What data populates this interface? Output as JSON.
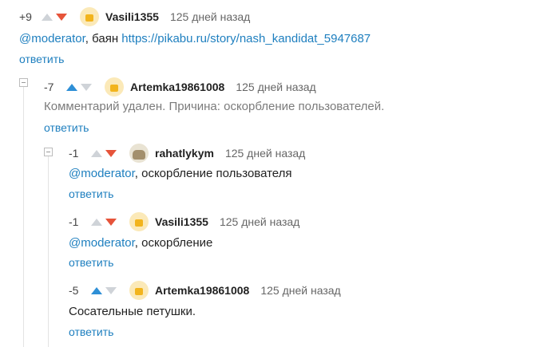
{
  "comments": [
    {
      "rating": "+9",
      "vote": "down",
      "avatar_icon": "default-avatar-icon",
      "user": "Vasili1355",
      "date": "125 дней назад",
      "body": {
        "mention": "@moderator",
        "text": ", баян ",
        "url": "https://pikabu.ru/story/nash_kandidat_5947687"
      },
      "reply_label": "ответить"
    },
    {
      "rating": "-7",
      "vote": "up",
      "avatar_icon": "default-avatar-icon",
      "user": "Artemka19861008",
      "date": "125 дней назад",
      "body": {
        "text": "Комментарий удален. Причина: оскорбление пользователей."
      },
      "reply_label": "ответить"
    },
    {
      "rating": "-1",
      "vote": "down",
      "avatar_icon": "cat-avatar-icon",
      "user": "rahatlykym",
      "date": "125 дней назад",
      "body": {
        "mention": "@moderator",
        "text": ", оскорбление пользователя"
      },
      "reply_label": "ответить"
    },
    {
      "rating": "-1",
      "vote": "down",
      "avatar_icon": "default-avatar-icon",
      "user": "Vasili1355",
      "date": "125 дней назад",
      "body": {
        "mention": "@moderator",
        "text": ", оскорбление"
      },
      "reply_label": "ответить"
    },
    {
      "rating": "-5",
      "vote": "up",
      "avatar_icon": "default-avatar-icon",
      "user": "Artemka19861008",
      "date": "125 дней назад",
      "body": {
        "text": "Сосательные петушки."
      },
      "reply_label": "ответить"
    }
  ]
}
